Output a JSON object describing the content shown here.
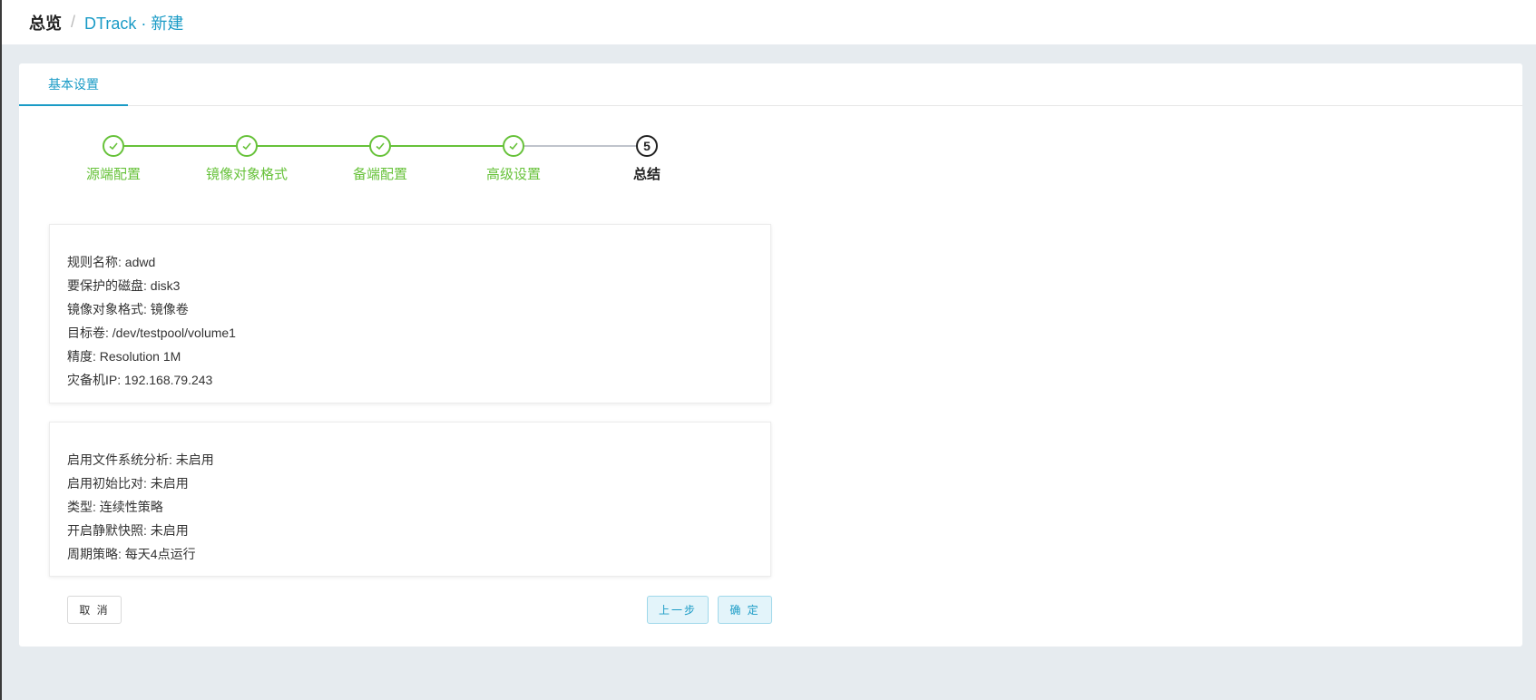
{
  "breadcrumb": {
    "home": "总览",
    "separator": "/",
    "current": "DTrack · 新建"
  },
  "tabs": [
    {
      "label": "基本设置",
      "active": true
    }
  ],
  "steps": [
    {
      "label": "源端配置",
      "status": "done",
      "icon": "check-icon"
    },
    {
      "label": "镜像对象格式",
      "status": "done",
      "icon": "check-icon"
    },
    {
      "label": "备端配置",
      "status": "done",
      "icon": "check-icon"
    },
    {
      "label": "高级设置",
      "status": "done",
      "icon": "check-icon"
    },
    {
      "label": "总结",
      "status": "active",
      "number": "5"
    }
  ],
  "summary_basic": [
    "规则名称: adwd",
    "要保护的磁盘: disk3",
    "镜像对象格式: 镜像卷",
    "目标卷: /dev/testpool/volume1",
    "精度: Resolution 1M",
    "灾备机IP: 192.168.79.243"
  ],
  "summary_advanced": [
    "启用文件系统分析: 未启用",
    "启用初始比对: 未启用",
    "类型: 连续性策略",
    "开启静默快照: 未启用",
    "周期策略: 每天4点运行"
  ],
  "buttons": {
    "cancel": "取 消",
    "prev": "上一步",
    "confirm": "确 定"
  },
  "colors": {
    "accent": "#1a9bc6",
    "success": "#67c23a",
    "background": "#e6ebef"
  }
}
